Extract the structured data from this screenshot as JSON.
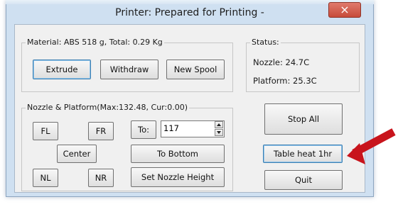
{
  "window": {
    "title": "Printer: Prepared for Printing -",
    "close_glyph": "×"
  },
  "material": {
    "label": "Material: ABS 518 g,  Total: 0.29 Kg",
    "extrude": "Extrude",
    "withdraw": "Withdraw",
    "new_spool": "New Spool"
  },
  "status": {
    "label": "Status:",
    "nozzle": "Nozzle: 24.7C",
    "platform": "Platform: 25.3C"
  },
  "nozzle_platform": {
    "label": "Nozzle & Platform(Max:132.48, Cur:0.00)",
    "fl": "FL",
    "fr": "FR",
    "to": "To:",
    "height_value": "117",
    "center": "Center",
    "to_bottom": "To Bottom",
    "nl": "NL",
    "nr": "NR",
    "set_nozzle_height": "Set Nozzle Height"
  },
  "actions": {
    "stop_all": "Stop All",
    "table_heat": "Table heat 1hr",
    "quit": "Quit"
  },
  "annotation": {
    "arrow_color": "#c8141c",
    "icon": "red-arrow-icon"
  }
}
